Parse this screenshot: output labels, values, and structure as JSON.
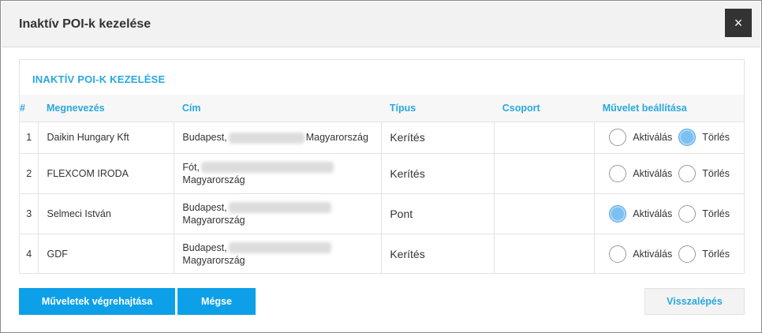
{
  "dialog": {
    "title": "Inaktív POI-k kezelése",
    "close_icon": "×"
  },
  "panel": {
    "title": "INAKTÍV POI-K KEZELÉSE"
  },
  "table": {
    "headers": {
      "num": "#",
      "name": "Megnevezés",
      "address": "Cím",
      "type": "Típus",
      "group": "Csoport",
      "action": "Művelet beállítása"
    },
    "rows": [
      {
        "num": "1",
        "name": "Daikin Hungary Kft",
        "city": "Budapest,",
        "country": "Magyarország",
        "type": "Kerítés",
        "group": "",
        "selected": "delete"
      },
      {
        "num": "2",
        "name": "FLEXCOM IRODA",
        "city": "Fót,",
        "country": "Magyarország",
        "type": "Kerítés",
        "group": "",
        "selected": "none"
      },
      {
        "num": "3",
        "name": "Selmeci István",
        "city": "Budapest,",
        "country": "Magyarország",
        "type": "Pont",
        "group": "",
        "selected": "activate"
      },
      {
        "num": "4",
        "name": "GDF",
        "city": "Budapest,",
        "country": "Magyarország",
        "type": "Kerítés",
        "group": "",
        "selected": "none"
      }
    ],
    "radio_labels": {
      "activate": "Aktiválás",
      "delete": "Törlés"
    }
  },
  "buttons": {
    "execute": "Műveletek végrehajtása",
    "cancel": "Mégse",
    "back": "Visszalépés"
  },
  "colors": {
    "accent": "#29a8e0",
    "primary_button": "#0da0e8",
    "radio_checked": "#7cc0f3"
  }
}
